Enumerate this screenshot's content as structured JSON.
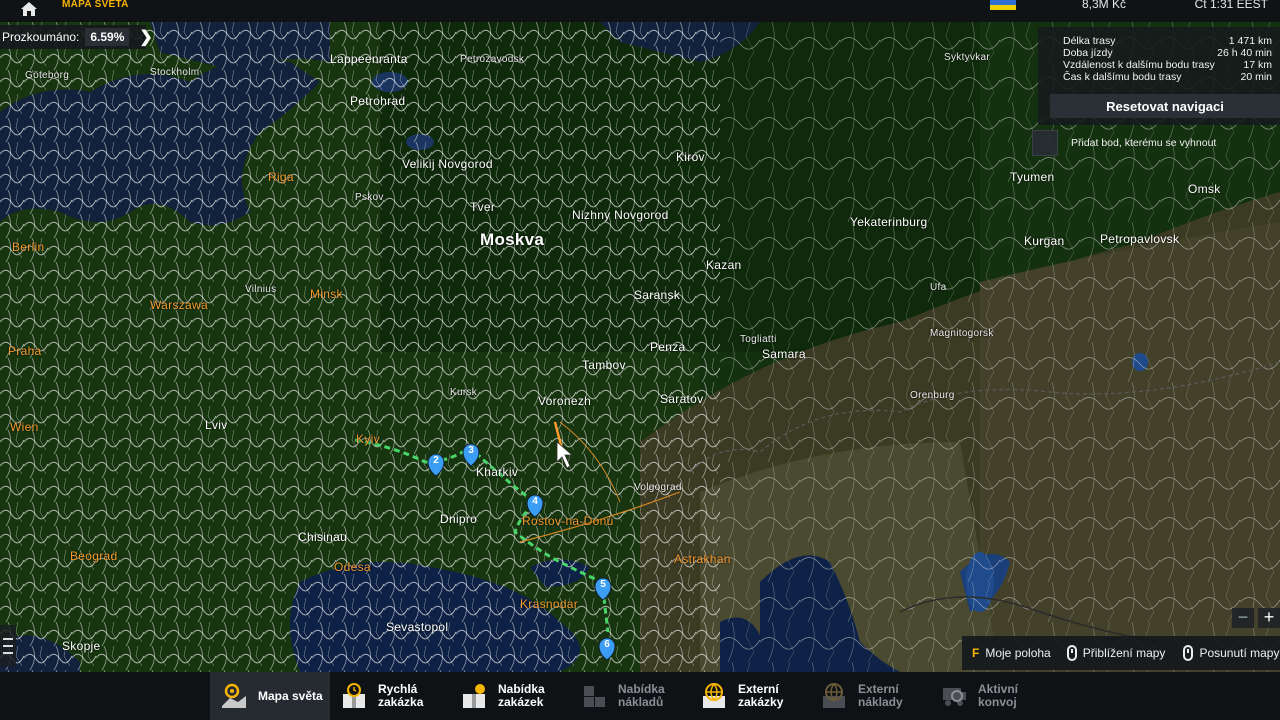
{
  "topbar": {
    "title": "MAPA SVĚTA",
    "money": "8,3M Kč",
    "clock": "Čt 1:31 EEST"
  },
  "explored": {
    "label": "Prozkoumáno:",
    "value": "6.59%"
  },
  "route": {
    "rows": [
      {
        "label": "Délka trasy",
        "value": "1 471 km"
      },
      {
        "label": "Doba jízdy",
        "value": "26 h 40 min"
      },
      {
        "label": "Vzdálenost k dalšímu bodu trasy",
        "value": "17 km"
      },
      {
        "label": "Čas k dalšímu bodu trasy",
        "value": "20 min"
      }
    ],
    "reset_label": "Resetovat navigaci",
    "avoid_label": "Přidat bod, kterému se vyhnout"
  },
  "hints": {
    "my_position_key": "F",
    "my_position": "Moje poloha",
    "zoom": "Přiblížení mapy",
    "pan": "Posunutí mapy"
  },
  "nav": [
    {
      "label": "Mapa světa",
      "state": "active",
      "icon": "globe-pin-icon"
    },
    {
      "label": "Rychlá zakázka",
      "state": "normal",
      "icon": "clock-box-icon"
    },
    {
      "label": "Nabídka zakázek",
      "state": "normal",
      "icon": "boxes-icon"
    },
    {
      "label": "Nabídka nákladů",
      "state": "dim",
      "icon": "crates-icon"
    },
    {
      "label": "Externí zakázky",
      "state": "normal",
      "icon": "globe-box-icon"
    },
    {
      "label": "Externí náklady",
      "state": "dim",
      "icon": "globe-crate-icon"
    },
    {
      "label": "Aktivní konvoj",
      "state": "dim",
      "icon": "convoy-icon"
    }
  ],
  "map_labels": [
    {
      "text": "Lappeenranta",
      "kind": "normal"
    },
    {
      "text": "Petrozavodsk",
      "kind": "small"
    },
    {
      "text": "Petrohrad",
      "kind": "normal"
    },
    {
      "text": "Stockholm",
      "kind": "small"
    },
    {
      "text": "Göteborg",
      "kind": "small"
    },
    {
      "text": "Riga",
      "kind": "org"
    },
    {
      "text": "Velikij Novgorod",
      "kind": "normal"
    },
    {
      "text": "Pskov",
      "kind": "small"
    },
    {
      "text": "Tver",
      "kind": "normal"
    },
    {
      "text": "Moskva",
      "kind": "big"
    },
    {
      "text": "Nizhny Novgorod",
      "kind": "normal"
    },
    {
      "text": "Kirov",
      "kind": "normal"
    },
    {
      "text": "Kazan",
      "kind": "normal"
    },
    {
      "text": "Saransk",
      "kind": "normal"
    },
    {
      "text": "Penza",
      "kind": "normal"
    },
    {
      "text": "Tambov",
      "kind": "normal"
    },
    {
      "text": "Voronezh",
      "kind": "normal"
    },
    {
      "text": "Saratov",
      "kind": "normal"
    },
    {
      "text": "Samara",
      "kind": "normal"
    },
    {
      "text": "Togliatti",
      "kind": "small"
    },
    {
      "text": "Orenburg",
      "kind": "small"
    },
    {
      "text": "Ufa",
      "kind": "small"
    },
    {
      "text": "Yekaterinburg",
      "kind": "normal"
    },
    {
      "text": "Tyumen",
      "kind": "normal"
    },
    {
      "text": "Kurgan",
      "kind": "normal"
    },
    {
      "text": "Petropavlovsk",
      "kind": "normal"
    },
    {
      "text": "Omsk",
      "kind": "normal"
    },
    {
      "text": "Magnitogorsk",
      "kind": "small"
    },
    {
      "text": "Syktyvkar",
      "kind": "small"
    },
    {
      "text": "Minsk",
      "kind": "org"
    },
    {
      "text": "Vilnius",
      "kind": "small"
    },
    {
      "text": "Berlin",
      "kind": "org"
    },
    {
      "text": "Warszawa",
      "kind": "org"
    },
    {
      "text": "Praha",
      "kind": "org"
    },
    {
      "text": "Wien",
      "kind": "org"
    },
    {
      "text": "Kyiv",
      "kind": "org"
    },
    {
      "text": "Kharkiv",
      "kind": "normal"
    },
    {
      "text": "Dnipro",
      "kind": "normal"
    },
    {
      "text": "Rostov-na-Donu",
      "kind": "org"
    },
    {
      "text": "Astrakhan",
      "kind": "org"
    },
    {
      "text": "Odesa",
      "kind": "org"
    },
    {
      "text": "Chisinau",
      "kind": "normal"
    },
    {
      "text": "Sevastopol",
      "kind": "normal"
    },
    {
      "text": "Beograd",
      "kind": "org"
    },
    {
      "text": "Skopje",
      "kind": "normal"
    },
    {
      "text": "Lviv",
      "kind": "normal"
    },
    {
      "text": "Kursk",
      "kind": "small"
    },
    {
      "text": "Krasnodar",
      "kind": "org"
    },
    {
      "text": "Volgograd",
      "kind": "small"
    }
  ],
  "route_points": [
    "2",
    "3",
    "4",
    "5",
    "6"
  ]
}
